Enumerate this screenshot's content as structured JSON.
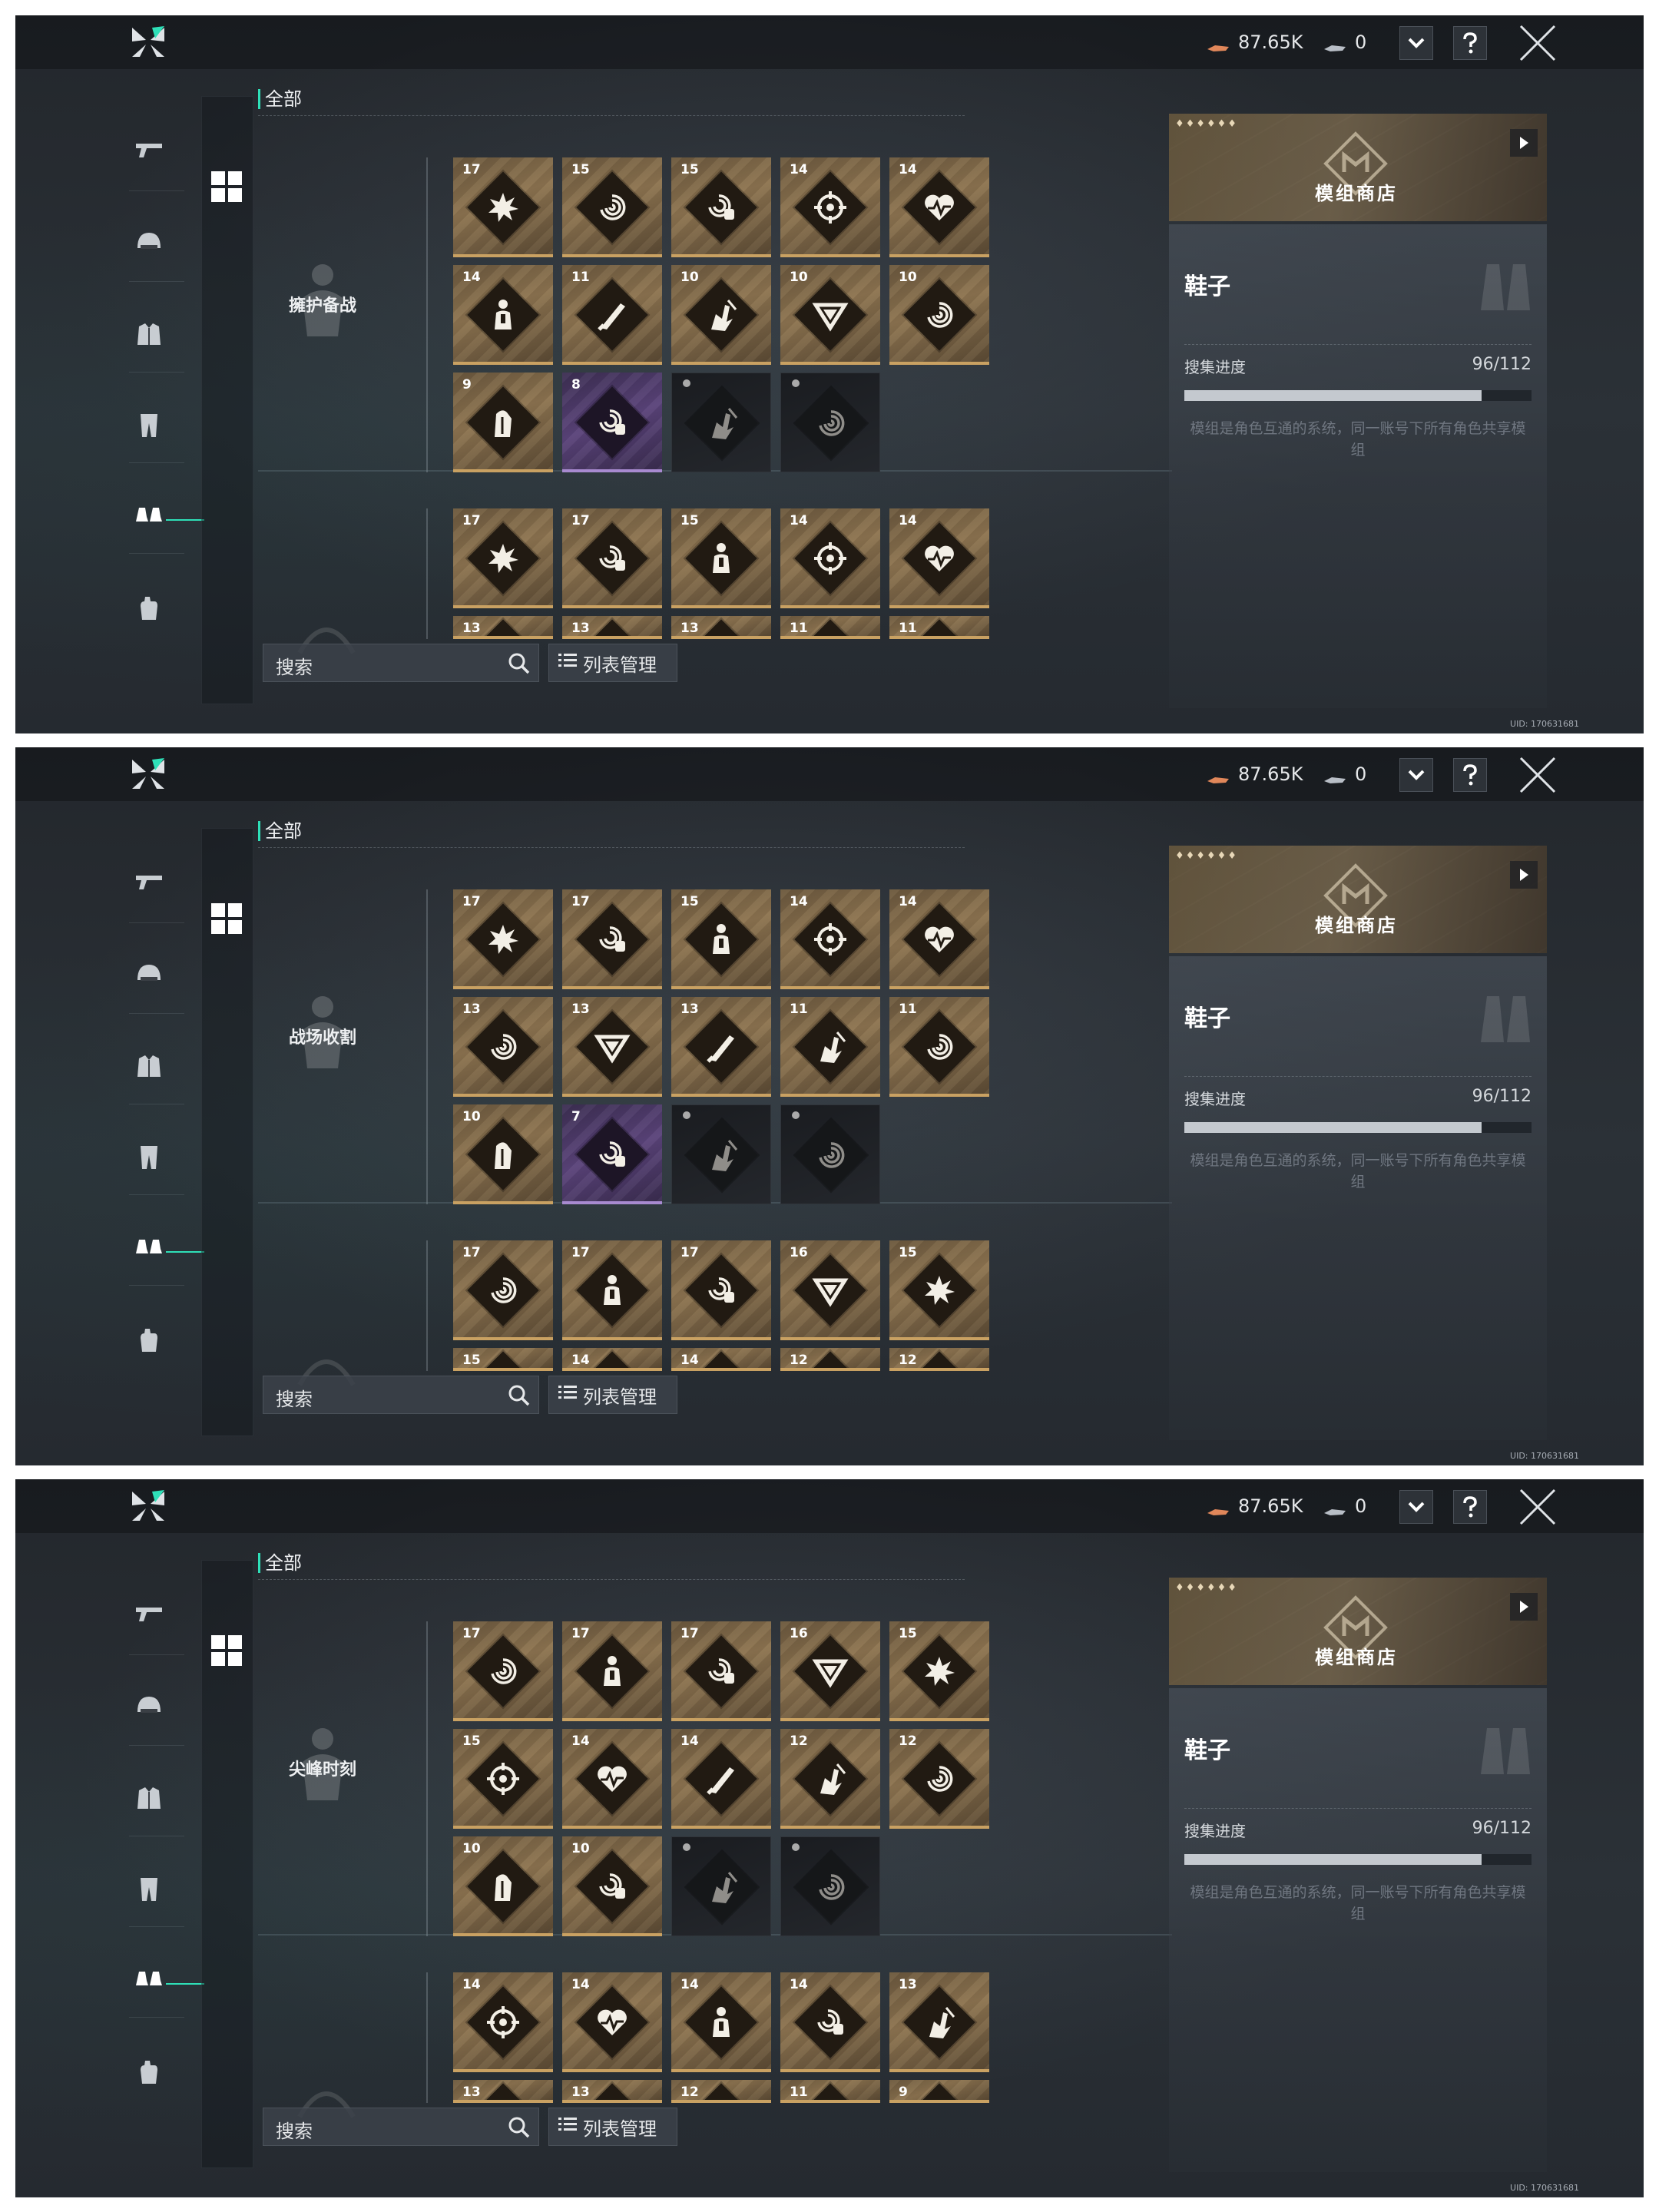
{
  "currency": [
    {
      "icon": "credits-icon",
      "value": "87.65K"
    },
    {
      "icon": "ticket-icon",
      "value": "0"
    }
  ],
  "tabs": [
    {
      "name": "weapon-tab",
      "icon": "gun-icon"
    },
    {
      "name": "helmet-tab",
      "icon": "helmet-icon"
    },
    {
      "name": "armor-tab",
      "icon": "armor-vest-icon"
    },
    {
      "name": "legs-tab",
      "icon": "leg-armor-icon"
    },
    {
      "name": "shoes-tab",
      "icon": "shoes-icon",
      "active": true
    },
    {
      "name": "gloves-tab",
      "icon": "glove-icon"
    }
  ],
  "filter_label": "全部",
  "search_label": "搜索",
  "list_manage_label": "列表管理",
  "shop_label": "模组商店",
  "shop_stars": "♦♦♦♦♦♦",
  "item_title": "鞋子",
  "progress_label": "搜集进度",
  "progress_value": "96/112",
  "progress_fraction": 0.857,
  "description": "模组是角色互通的系统，同一账号下所有角色共享模组",
  "uid": "UID: 170631681",
  "accent_color": "#2ee0b8",
  "panels": [
    {
      "set_name": "擁护备战",
      "rows": [
        [
          {
            "lvl": "17",
            "icon": "explosion-icon",
            "tier": "gold"
          },
          {
            "lvl": "15",
            "icon": "spiral-icon",
            "tier": "gold"
          },
          {
            "lvl": "15",
            "icon": "spiral-hand-icon",
            "tier": "gold"
          },
          {
            "lvl": "14",
            "icon": "crosshair-icon",
            "tier": "gold"
          },
          {
            "lvl": "14",
            "icon": "heartbeat-icon",
            "tier": "gold"
          }
        ],
        [
          {
            "lvl": "14",
            "icon": "soldier-icon",
            "tier": "gold"
          },
          {
            "lvl": "11",
            "icon": "blade-icon",
            "tier": "gold"
          },
          {
            "lvl": "10",
            "icon": "slash-hand-icon",
            "tier": "gold"
          },
          {
            "lvl": "10",
            "icon": "triangle-icon",
            "tier": "gold"
          },
          {
            "lvl": "10",
            "icon": "spiral-icon",
            "tier": "gold"
          }
        ],
        [
          {
            "lvl": "9",
            "icon": "figure-icon",
            "tier": "gold"
          },
          {
            "lvl": "8",
            "icon": "spiral-hand-icon",
            "tier": "purple"
          },
          {
            "lvl": "",
            "icon": "slash-hand-icon",
            "tier": "dark"
          },
          {
            "lvl": "",
            "icon": "spiral-icon",
            "tier": "dark"
          }
        ]
      ],
      "rows2": [
        [
          {
            "lvl": "17",
            "icon": "explosion-icon",
            "tier": "gold"
          },
          {
            "lvl": "17",
            "icon": "spiral-hand-icon",
            "tier": "gold"
          },
          {
            "lvl": "15",
            "icon": "soldier-icon",
            "tier": "gold"
          },
          {
            "lvl": "14",
            "icon": "crosshair-icon",
            "tier": "gold"
          },
          {
            "lvl": "14",
            "icon": "heartbeat-icon",
            "tier": "gold"
          }
        ],
        [
          {
            "lvl": "13",
            "icon": "",
            "tier": "gold"
          },
          {
            "lvl": "13",
            "icon": "",
            "tier": "gold"
          },
          {
            "lvl": "13",
            "icon": "",
            "tier": "gold"
          },
          {
            "lvl": "11",
            "icon": "",
            "tier": "gold"
          },
          {
            "lvl": "11",
            "icon": "",
            "tier": "gold"
          }
        ]
      ]
    },
    {
      "set_name": "战场收割",
      "rows": [
        [
          {
            "lvl": "17",
            "icon": "explosion-icon",
            "tier": "gold"
          },
          {
            "lvl": "17",
            "icon": "spiral-hand-icon",
            "tier": "gold"
          },
          {
            "lvl": "15",
            "icon": "soldier-icon",
            "tier": "gold"
          },
          {
            "lvl": "14",
            "icon": "crosshair-icon",
            "tier": "gold"
          },
          {
            "lvl": "14",
            "icon": "heartbeat-icon",
            "tier": "gold"
          }
        ],
        [
          {
            "lvl": "13",
            "icon": "spiral-icon",
            "tier": "gold"
          },
          {
            "lvl": "13",
            "icon": "triangle-icon",
            "tier": "gold"
          },
          {
            "lvl": "13",
            "icon": "blade-icon",
            "tier": "gold"
          },
          {
            "lvl": "11",
            "icon": "slash-hand-icon",
            "tier": "gold"
          },
          {
            "lvl": "11",
            "icon": "spiral-icon",
            "tier": "gold"
          }
        ],
        [
          {
            "lvl": "10",
            "icon": "figure-icon",
            "tier": "gold"
          },
          {
            "lvl": "7",
            "icon": "spiral-hand-icon",
            "tier": "purple"
          },
          {
            "lvl": "",
            "icon": "slash-hand-icon",
            "tier": "dark"
          },
          {
            "lvl": "",
            "icon": "spiral-icon",
            "tier": "dark"
          }
        ]
      ],
      "rows2": [
        [
          {
            "lvl": "17",
            "icon": "spiral-icon",
            "tier": "gold"
          },
          {
            "lvl": "17",
            "icon": "soldier-icon",
            "tier": "gold"
          },
          {
            "lvl": "17",
            "icon": "spiral-hand-icon",
            "tier": "gold"
          },
          {
            "lvl": "16",
            "icon": "triangle-icon",
            "tier": "gold"
          },
          {
            "lvl": "15",
            "icon": "explosion-icon",
            "tier": "gold"
          }
        ],
        [
          {
            "lvl": "15",
            "icon": "",
            "tier": "gold"
          },
          {
            "lvl": "14",
            "icon": "",
            "tier": "gold"
          },
          {
            "lvl": "14",
            "icon": "",
            "tier": "gold"
          },
          {
            "lvl": "12",
            "icon": "",
            "tier": "gold"
          },
          {
            "lvl": "12",
            "icon": "",
            "tier": "gold"
          }
        ]
      ]
    },
    {
      "set_name": "尖峰时刻",
      "rows": [
        [
          {
            "lvl": "17",
            "icon": "spiral-icon",
            "tier": "gold"
          },
          {
            "lvl": "17",
            "icon": "soldier-icon",
            "tier": "gold"
          },
          {
            "lvl": "17",
            "icon": "spiral-hand-icon",
            "tier": "gold"
          },
          {
            "lvl": "16",
            "icon": "triangle-icon",
            "tier": "gold"
          },
          {
            "lvl": "15",
            "icon": "explosion-icon",
            "tier": "gold"
          }
        ],
        [
          {
            "lvl": "15",
            "icon": "crosshair-icon",
            "tier": "gold"
          },
          {
            "lvl": "14",
            "icon": "heartbeat-icon",
            "tier": "gold"
          },
          {
            "lvl": "14",
            "icon": "blade-icon",
            "tier": "gold"
          },
          {
            "lvl": "12",
            "icon": "slash-hand-icon",
            "tier": "gold"
          },
          {
            "lvl": "12",
            "icon": "spiral-icon",
            "tier": "gold"
          }
        ],
        [
          {
            "lvl": "10",
            "icon": "figure-icon",
            "tier": "gold"
          },
          {
            "lvl": "10",
            "icon": "spiral-hand-icon",
            "tier": "gold"
          },
          {
            "lvl": "",
            "icon": "slash-hand-icon",
            "tier": "dark"
          },
          {
            "lvl": "",
            "icon": "spiral-icon",
            "tier": "dark"
          }
        ]
      ],
      "rows2": [
        [
          {
            "lvl": "14",
            "icon": "crosshair-icon",
            "tier": "gold"
          },
          {
            "lvl": "14",
            "icon": "heartbeat-icon",
            "tier": "gold"
          },
          {
            "lvl": "14",
            "icon": "soldier-icon",
            "tier": "gold"
          },
          {
            "lvl": "14",
            "icon": "spiral-hand-icon",
            "tier": "gold"
          },
          {
            "lvl": "13",
            "icon": "slash-hand-icon",
            "tier": "gold"
          }
        ],
        [
          {
            "lvl": "13",
            "icon": "",
            "tier": "gold"
          },
          {
            "lvl": "13",
            "icon": "",
            "tier": "gold"
          },
          {
            "lvl": "12",
            "icon": "",
            "tier": "gold"
          },
          {
            "lvl": "11",
            "icon": "",
            "tier": "gold"
          },
          {
            "lvl": "9",
            "icon": "",
            "tier": "gold"
          }
        ]
      ]
    }
  ]
}
